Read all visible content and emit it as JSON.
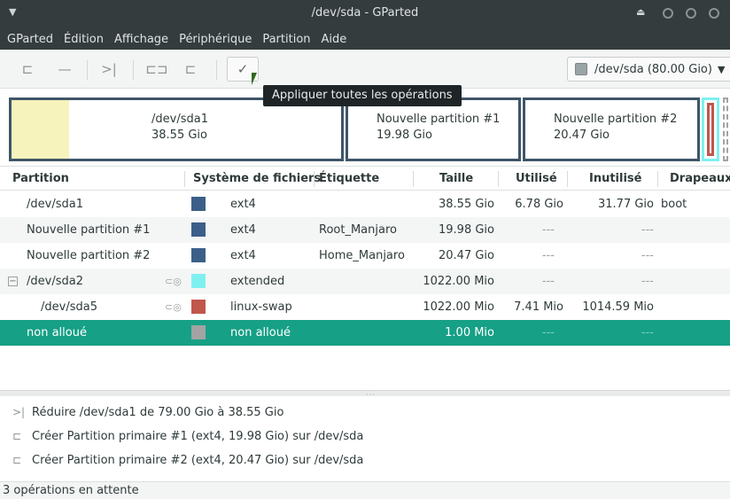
{
  "window": {
    "title": "/dev/sda - GParted",
    "menu_icon": "chevron-down-icon",
    "eject_icon": "eject-icon"
  },
  "menubar": [
    "GParted",
    "Édition",
    "Affichage",
    "Périphérique",
    "Partition",
    "Aide"
  ],
  "toolbar": {
    "buttons": [
      {
        "name": "new-partition-button",
        "icon": "new-partition-icon",
        "glyph": "⊏"
      },
      {
        "name": "delete-partition-button",
        "icon": "minus-icon",
        "glyph": "—"
      },
      {
        "name": "resize-move-button",
        "icon": "resize-icon",
        "glyph": ">|"
      },
      {
        "name": "copy-button",
        "icon": "copy-icon",
        "glyph": "⊏⊐"
      },
      {
        "name": "paste-button",
        "icon": "paste-icon",
        "glyph": "⊏"
      },
      {
        "name": "apply-button",
        "icon": "checkmark-icon",
        "glyph": "✓"
      }
    ],
    "device_selector": "/dev/sda  (80.00 Gio)"
  },
  "tooltip": "Appliquer toutes les opérations",
  "disk_map": [
    {
      "name": "/dev/sda1",
      "size": "38.55 Gio",
      "used_fraction": 0.176
    },
    {
      "name": "Nouvelle partition #1",
      "size": "19.98 Gio"
    },
    {
      "name": "Nouvelle partition #2",
      "size": "20.47 Gio"
    }
  ],
  "table": {
    "headers": [
      "Partition",
      "Système de fichiers",
      "Étiquette",
      "Taille",
      "Utilisé",
      "Inutilisé",
      "Drapeaux"
    ],
    "rows": [
      {
        "partition": "/dev/sda1",
        "fs": "ext4",
        "color": "#3b5f88",
        "label": "",
        "size": "38.55 Gio",
        "used": "6.78 Gio",
        "unused": "31.77 Gio",
        "flags": "boot"
      },
      {
        "partition": "Nouvelle partition #1",
        "fs": "ext4",
        "color": "#3b5f88",
        "label": "Root_Manjaro",
        "size": "19.98 Gio",
        "used": "---",
        "unused": "---",
        "flags": ""
      },
      {
        "partition": "Nouvelle partition #2",
        "fs": "ext4",
        "color": "#3b5f88",
        "label": "Home_Manjaro",
        "size": "20.47 Gio",
        "used": "---",
        "unused": "---",
        "flags": ""
      },
      {
        "partition": "/dev/sda2",
        "fs": "extended",
        "color": "#7ff0f0",
        "label": "",
        "size": "1022.00 Mio",
        "used": "---",
        "unused": "---",
        "flags": "",
        "expander": "−"
      },
      {
        "partition": "/dev/sda5",
        "fs": "linux-swap",
        "color": "#c1564c",
        "label": "",
        "size": "1022.00 Mio",
        "used": "7.41 Mio",
        "unused": "1014.59 Mio",
        "flags": ""
      },
      {
        "partition": "non alloué",
        "fs": "non alloué",
        "color": "#a3a3a3",
        "label": "",
        "size": "1.00 Mio",
        "used": "---",
        "unused": "---",
        "flags": ""
      }
    ]
  },
  "operations": [
    {
      "icon": "resize-icon",
      "glyph": ">|",
      "text": "Réduire /dev/sda1 de 79.00 Gio à 38.55 Gio"
    },
    {
      "icon": "new-partition-icon",
      "glyph": "⊏",
      "text": "Créer Partition primaire #1 (ext4, 19.98 Gio) sur /dev/sda"
    },
    {
      "icon": "new-partition-icon",
      "glyph": "⊏",
      "text": "Créer Partition primaire #2 (ext4, 20.47 Gio) sur /dev/sda"
    }
  ],
  "status": "3 opérations en attente",
  "colors": {
    "accent": "#16a086",
    "titlebar": "#353c3e",
    "ext4": "#3b5f88",
    "extended": "#7ff0f0",
    "swap": "#c1564c",
    "unallocated": "#a3a3a3"
  }
}
